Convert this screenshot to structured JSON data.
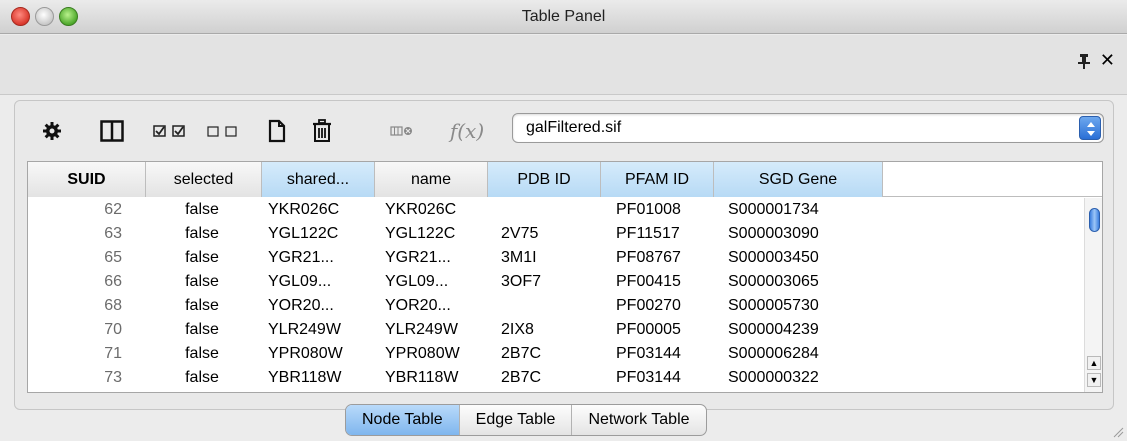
{
  "window": {
    "title": "Table Panel"
  },
  "toolbar": {
    "icons": [
      "gear-icon",
      "columns-icon",
      "select-all-icon",
      "deselect-all-icon",
      "new-column-icon",
      "delete-icon",
      "function-builder-icon",
      "formula-icon"
    ],
    "formula_label": "f(x)",
    "network_select": {
      "value": "galFiltered.sif"
    }
  },
  "table": {
    "columns": [
      "SUID",
      "selected",
      "shared...",
      "name",
      "PDB ID",
      "PFAM ID",
      "SGD Gene"
    ],
    "rows": [
      [
        "62",
        "false",
        "YKR026C",
        "YKR026C",
        "",
        "PF01008",
        "S000001734"
      ],
      [
        "63",
        "false",
        "YGL122C",
        "YGL122C",
        "2V75",
        "PF11517",
        "S000003090"
      ],
      [
        "65",
        "false",
        "YGR21...",
        "YGR21...",
        "3M1I",
        "PF08767",
        "S000003450"
      ],
      [
        "66",
        "false",
        "YGL09...",
        "YGL09...",
        "3OF7",
        "PF00415",
        "S000003065"
      ],
      [
        "68",
        "false",
        "YOR20...",
        "YOR20...",
        "",
        "PF00270",
        "S000005730"
      ],
      [
        "70",
        "false",
        "YLR249W",
        "YLR249W",
        "2IX8",
        "PF00005",
        "S000004239"
      ],
      [
        "71",
        "false",
        "YPR080W",
        "YPR080W",
        "2B7C",
        "PF03144",
        "S000006284"
      ],
      [
        "73",
        "false",
        "YBR118W",
        "YBR118W",
        "2B7C",
        "PF03144",
        "S000000322"
      ]
    ]
  },
  "tabs": [
    {
      "label": "Node Table",
      "active": true
    },
    {
      "label": "Edge Table",
      "active": false
    },
    {
      "label": "Network Table",
      "active": false
    }
  ],
  "colors": {
    "accent": "#7fb6ee",
    "header_highlight": "#b7daf5"
  }
}
